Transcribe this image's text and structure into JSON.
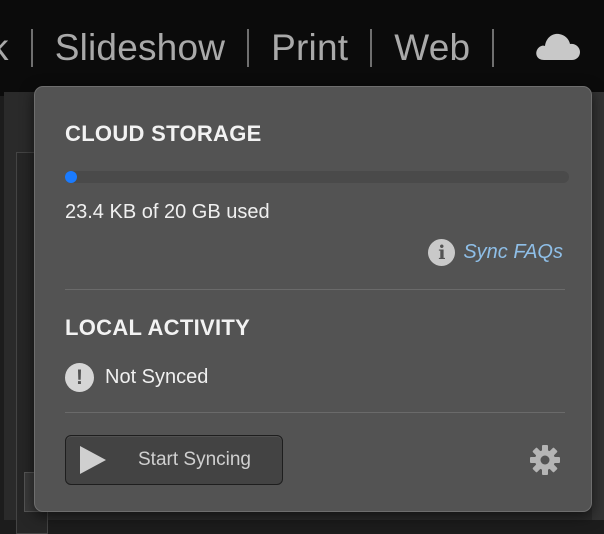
{
  "module_nav": {
    "items": [
      {
        "label": "k"
      },
      {
        "label": "Slideshow"
      },
      {
        "label": "Print"
      },
      {
        "label": "Web"
      }
    ],
    "cloud_icon": "cloud-icon"
  },
  "cloud_storage": {
    "title": "CLOUD STORAGE",
    "usage_text": "23.4 KB of 20 GB used",
    "usage_fraction": 1.1e-06,
    "bar_color": "#1a7bff",
    "faq_icon": "info-icon",
    "faq_link": "Sync FAQs"
  },
  "local_activity": {
    "title": "LOCAL ACTIVITY",
    "status_icon": "warning-icon",
    "status_text": "Not Synced"
  },
  "actions": {
    "start_sync_label": "Start Syncing",
    "play_icon": "play-icon",
    "settings_icon": "gear-icon"
  }
}
